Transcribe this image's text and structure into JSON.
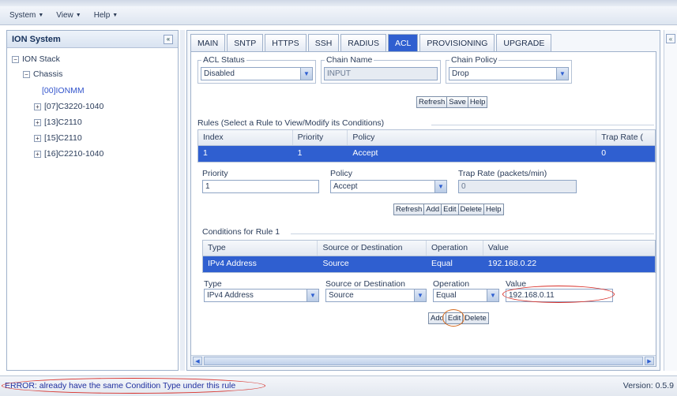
{
  "menubar": {
    "items": [
      {
        "label": "System"
      },
      {
        "label": "View"
      },
      {
        "label": "Help"
      }
    ]
  },
  "tree": {
    "title": "ION System",
    "nodes": [
      {
        "label": "ION Stack",
        "expander": "−"
      },
      {
        "label": "Chassis",
        "expander": "−"
      },
      {
        "label": "[00]IONMM",
        "expander": ""
      },
      {
        "label": "[07]C3220-1040",
        "expander": "+"
      },
      {
        "label": "[13]C2110",
        "expander": "+"
      },
      {
        "label": "[15]C2110",
        "expander": "+"
      },
      {
        "label": "[16]C2210-1040",
        "expander": "+"
      }
    ]
  },
  "tabs": [
    {
      "label": "MAIN"
    },
    {
      "label": "SNTP"
    },
    {
      "label": "HTTPS"
    },
    {
      "label": "SSH"
    },
    {
      "label": "RADIUS"
    },
    {
      "label": "ACL",
      "active": true
    },
    {
      "label": "PROVISIONING"
    },
    {
      "label": "UPGRADE"
    }
  ],
  "acl": {
    "status_legend": "ACL Status",
    "status_value": "Disabled",
    "chain_name_legend": "Chain Name",
    "chain_name_value": "INPUT",
    "chain_policy_legend": "Chain Policy",
    "chain_policy_value": "Drop",
    "buttons": {
      "refresh": "Refresh",
      "save": "Save",
      "help": "Help"
    }
  },
  "rules": {
    "section_title": "Rules (Select a Rule to View/Modify its Conditions)",
    "columns": [
      "Index",
      "Priority",
      "Policy",
      "Trap Rate ("
    ],
    "row": {
      "index": "1",
      "priority": "1",
      "policy": "Accept",
      "trap_rate": "0"
    },
    "form": {
      "priority_label": "Priority",
      "priority_value": "1",
      "policy_label": "Policy",
      "policy_value": "Accept",
      "trap_label": "Trap Rate (packets/min)",
      "trap_value": "0"
    },
    "buttons": {
      "refresh": "Refresh",
      "add": "Add",
      "edit": "Edit",
      "delete": "Delete",
      "help": "Help"
    }
  },
  "conditions": {
    "section_title": "Conditions for Rule 1",
    "columns": [
      "Type",
      "Source or Destination",
      "Operation",
      "Value"
    ],
    "row": {
      "type": "IPv4 Address",
      "source": "Source",
      "operation": "Equal",
      "value": "192.168.0.22"
    },
    "form": {
      "type_label": "Type",
      "type_value": "IPv4 Address",
      "source_label": "Source or Destination",
      "source_value": "Source",
      "operation_label": "Operation",
      "operation_value": "Equal",
      "value_label": "Value",
      "value_value": "192.168.0.11"
    },
    "buttons": {
      "add": "Add",
      "edit": "Edit",
      "delete": "Delete"
    }
  },
  "status": {
    "message": "ERROR: already have the same Condition Type under this rule",
    "version": "Version: 0.5.9"
  },
  "colors": {
    "accent": "#2f5fd0",
    "annotation": "#d8302a"
  }
}
